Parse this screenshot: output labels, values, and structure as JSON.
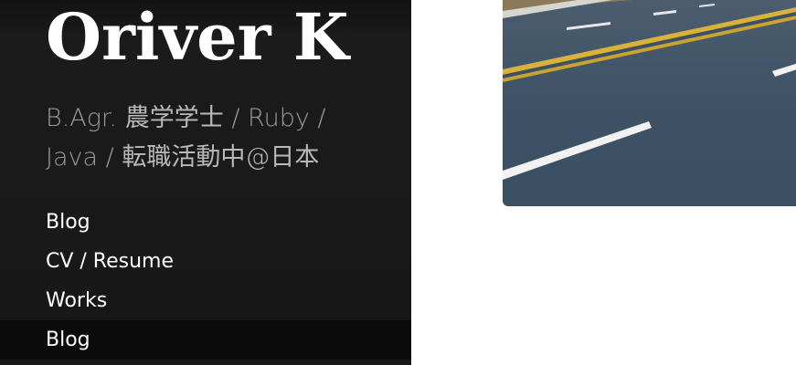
{
  "site": {
    "title": "Oriver K",
    "tagline_prefix": "B.Agr.",
    "tagline_degree": "農学学士",
    "tagline_sep1": "/",
    "tagline_lang1": "Ruby",
    "tagline_sep2": "/",
    "tagline_lang2": "Java",
    "tagline_sep3": "/",
    "tagline_status": "転職活動中@日本"
  },
  "nav": {
    "items": [
      {
        "label": "Blog"
      },
      {
        "label": "CV / Resume"
      },
      {
        "label": "Works"
      },
      {
        "label": "Blog"
      }
    ]
  },
  "hero": {
    "subject": "road-photo"
  },
  "colors": {
    "sidebar_bg": "#191919",
    "title": "#ffffff",
    "tagline": "#9a9a9a",
    "nav_text": "#ffffff",
    "road": "#3f5368",
    "center_line": "#d9b23a"
  }
}
